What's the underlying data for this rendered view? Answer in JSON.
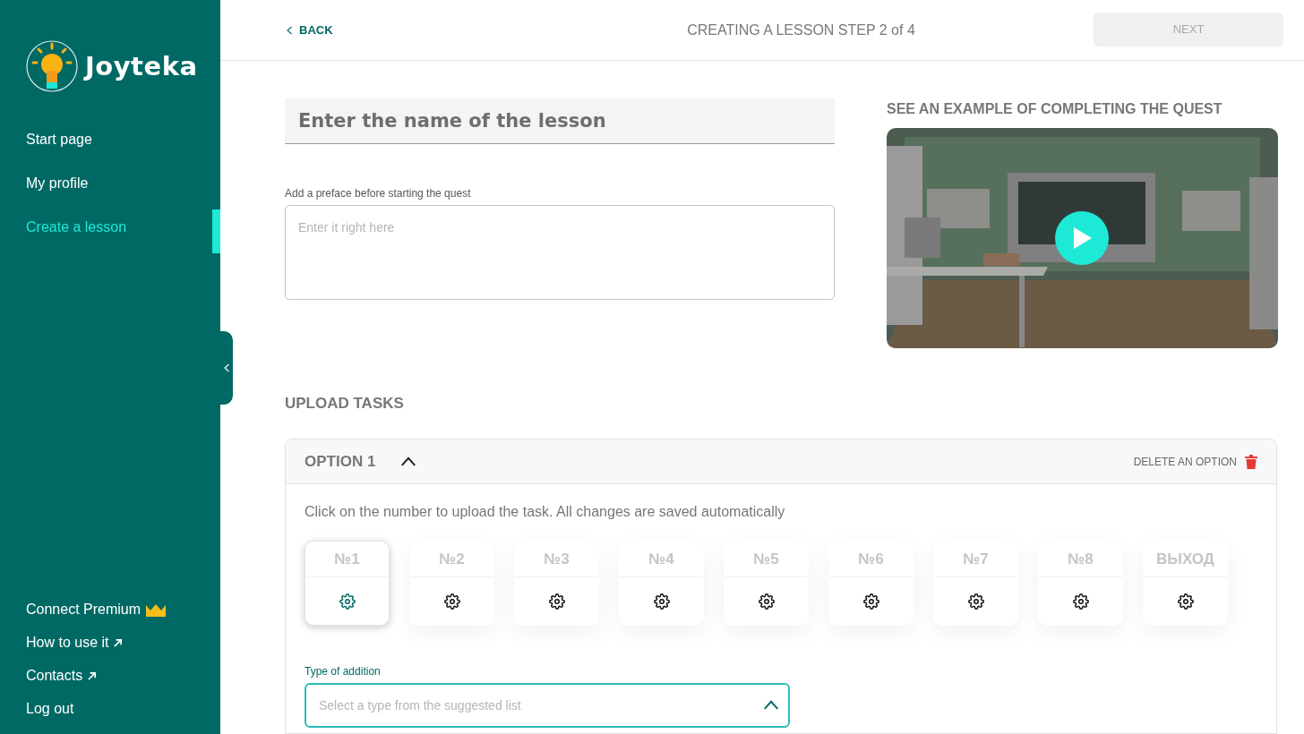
{
  "sidebar": {
    "logo": "Joyteka",
    "nav": [
      {
        "label": "Start page",
        "selected": false
      },
      {
        "label": "My profile",
        "selected": false
      },
      {
        "label": "Create a lesson",
        "selected": true
      }
    ],
    "links": [
      {
        "label": "Connect Premium",
        "kind": "premium"
      },
      {
        "label": "How to use it",
        "kind": "external"
      },
      {
        "label": "Contacts",
        "kind": "external"
      },
      {
        "label": "Log out",
        "kind": "plain"
      }
    ]
  },
  "header": {
    "back": "BACK",
    "title": "CREATING A LESSON STEP 2 of 4",
    "next": {
      "label": "NEXT",
      "disabled": true
    }
  },
  "lesson_name": {
    "placeholder": "Enter the name of the lesson"
  },
  "preface": {
    "label": "Add a preface before starting the quest",
    "placeholder": "Enter it right here"
  },
  "example": {
    "title": "SEE AN EXAMPLE OF COMPLETING THE QUEST"
  },
  "upload": {
    "title": "UPLOAD TASKS",
    "option": {
      "title": "OPTION 1",
      "expanded": true,
      "delete": "DELETE AN OPTION",
      "hint": "Click on the number to upload the task. All changes are saved automatically",
      "tasks": [
        {
          "label": "№1",
          "selected": true
        },
        {
          "label": "№2",
          "selected": false
        },
        {
          "label": "№3",
          "selected": false
        },
        {
          "label": "№4",
          "selected": false
        },
        {
          "label": "№5",
          "selected": false
        },
        {
          "label": "№6",
          "selected": false
        },
        {
          "label": "№7",
          "selected": false
        },
        {
          "label": "№8",
          "selected": false
        },
        {
          "label": "ВЫХОД",
          "selected": false
        }
      ],
      "type_field": {
        "label": "Type of addition",
        "placeholder": "Select a type from the suggested list",
        "expanded": true
      }
    }
  }
}
